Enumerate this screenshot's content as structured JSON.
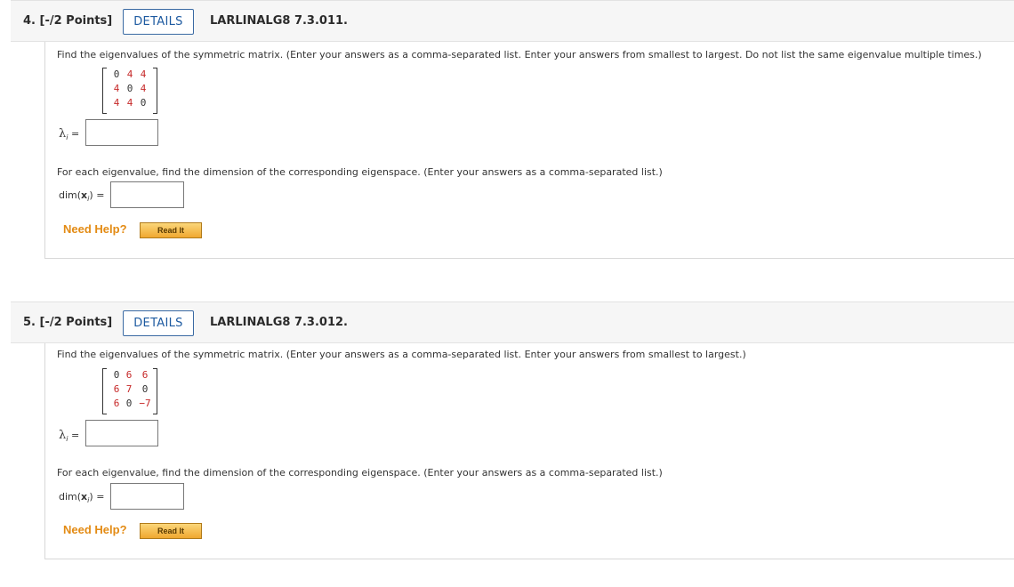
{
  "questions": [
    {
      "number": "4.",
      "points": "[-/2 Points]",
      "details_label": "DETAILS",
      "reference": "LARLINALG8 7.3.011.",
      "prompt1": "Find the eigenvalues of the symmetric matrix. (Enter your answers as a comma-separated list. Enter your answers from smallest to largest. Do not list the same eigenvalue multiple times.)",
      "matrix": [
        [
          "0",
          "4",
          "4"
        ],
        [
          "4",
          "0",
          "4"
        ],
        [
          "4",
          "4",
          "0"
        ]
      ],
      "lambda_symbol": "λ",
      "lambda_sub": "i",
      "equals": "=",
      "eigenvalue_input_value": "",
      "prompt2": "For each eigenvalue, find the dimension of the corresponding eigenspace. (Enter your answers as a comma-separated list.)",
      "dim_prefix": "dim(",
      "dim_var": "x",
      "dim_sub": "i",
      "dim_suffix": ")",
      "dimension_input_value": "",
      "need_help_label": "Need Help?",
      "read_it_label": "Read It"
    },
    {
      "number": "5.",
      "points": "[-/2 Points]",
      "details_label": "DETAILS",
      "reference": "LARLINALG8 7.3.012.",
      "prompt1": "Find the eigenvalues of the symmetric matrix. (Enter your answers as a comma-separated list. Enter your answers from smallest to largest.)",
      "matrix": [
        [
          "0",
          "6",
          "6"
        ],
        [
          "6",
          "7",
          "0"
        ],
        [
          "6",
          "0",
          "−7"
        ]
      ],
      "lambda_symbol": "λ",
      "lambda_sub": "i",
      "equals": "=",
      "eigenvalue_input_value": "",
      "prompt2": "For each eigenvalue, find the dimension of the corresponding eigenspace. (Enter your answers as a comma-separated list.)",
      "dim_prefix": "dim(",
      "dim_var": "x",
      "dim_sub": "i",
      "dim_suffix": ")",
      "dimension_input_value": "",
      "need_help_label": "Need Help?",
      "read_it_label": "Read It"
    }
  ],
  "colors": {
    "details_border": "#3a6aa3",
    "matrix_red": "#c62828",
    "need_help": "#e38b14"
  }
}
